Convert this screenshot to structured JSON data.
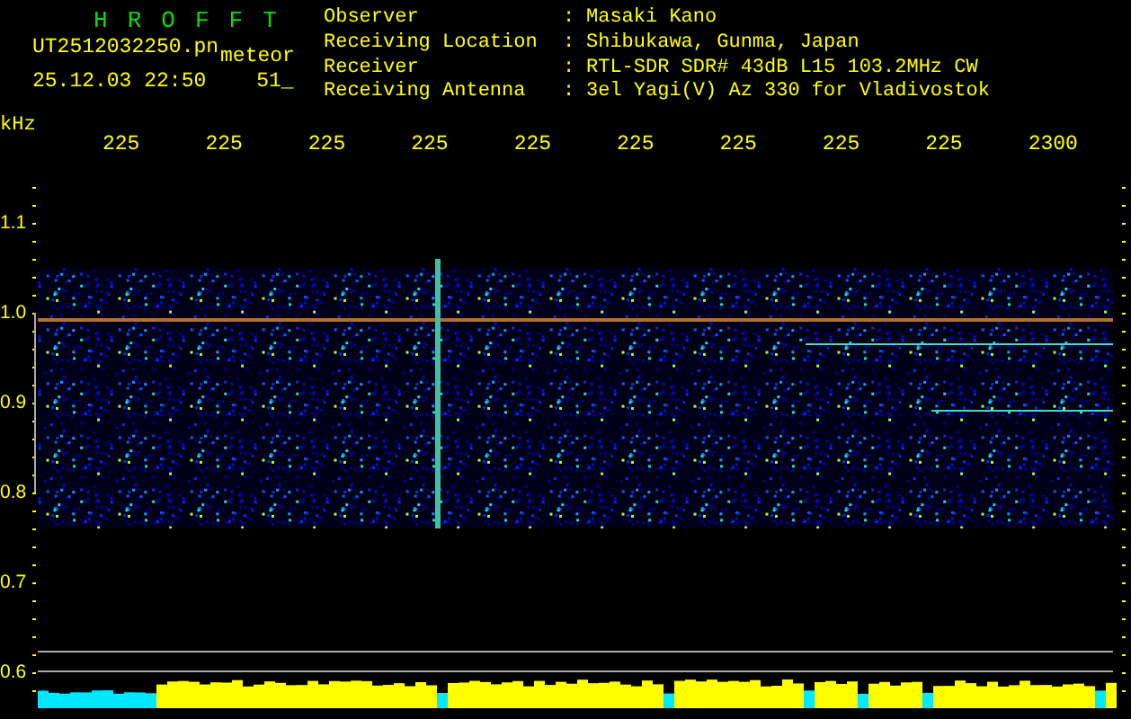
{
  "app_title": [
    "H",
    "R",
    "O",
    "F",
    "F",
    "T"
  ],
  "file_name": "UT2512032250.pn",
  "mode": "meteor",
  "timestamp": "25.12.03 22:50",
  "counter": "51_",
  "station_info": [
    {
      "label": "Observer",
      "separator": ":",
      "value": "Masaki Kano"
    },
    {
      "label": "Receiving Location",
      "separator": ":",
      "value": "Shibukawa, Gunma, Japan"
    },
    {
      "label": "Receiver",
      "separator": ":",
      "value": "RTL-SDR SDR# 43dB L15 103.2MHz CW"
    },
    {
      "label": "Receiving Antenna",
      "separator": ":",
      "value": "3el Yagi(V) Az 330 for Vladivostok"
    }
  ],
  "y_unit": "kHz",
  "time_labels": [
    "225",
    "225",
    "225",
    "225",
    "225",
    "225",
    "225",
    "225",
    "225",
    "2300"
  ],
  "frequency_labels": [
    "1.1",
    "1.0",
    "0.9",
    "0.8",
    "0.7",
    "0.6"
  ]
}
